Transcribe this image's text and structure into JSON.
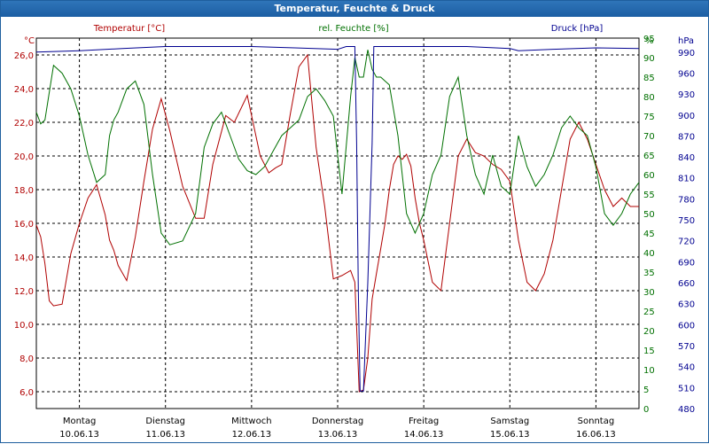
{
  "window": {
    "title": "Temperatur, Feuchte & Druck"
  },
  "colors": {
    "temperature": "#b00000",
    "humidity": "#007000",
    "pressure": "#000090",
    "grid": "#000000"
  },
  "chart_data": {
    "type": "line",
    "title": "Temperatur, Feuchte & Druck",
    "x_categories": [
      {
        "day": "Montag",
        "date": "10.06.13"
      },
      {
        "day": "Dienstag",
        "date": "11.06.13"
      },
      {
        "day": "Mittwoch",
        "date": "12.06.13"
      },
      {
        "day": "Donnerstag",
        "date": "13.06.13"
      },
      {
        "day": "Freitag",
        "date": "14.06.13"
      },
      {
        "day": "Samstag",
        "date": "15.06.13"
      },
      {
        "day": "Sonntag",
        "date": "16.06.13"
      }
    ],
    "x_range_days": [
      0,
      7
    ],
    "grid": true,
    "axes": {
      "temperature": {
        "label": "Temperatur [°C]",
        "unit": "°C",
        "range": [
          5,
          27
        ],
        "ticks": [
          "6,0",
          "8,0",
          "10,0",
          "12,0",
          "14,0",
          "16,0",
          "18,0",
          "20,0",
          "22,0",
          "24,0",
          "26,0"
        ],
        "tick_values": [
          6,
          8,
          10,
          12,
          14,
          16,
          18,
          20,
          22,
          24,
          26
        ]
      },
      "humidity": {
        "label": "rel. Feuchte [%]",
        "unit": "%",
        "range": [
          0,
          95
        ],
        "ticks": [
          "0",
          "5",
          "10",
          "15",
          "20",
          "25",
          "30",
          "35",
          "40",
          "45",
          "50",
          "55",
          "60",
          "65",
          "70",
          "75",
          "80",
          "85",
          "90",
          "95"
        ],
        "tick_values": [
          0,
          5,
          10,
          15,
          20,
          25,
          30,
          35,
          40,
          45,
          50,
          55,
          60,
          65,
          70,
          75,
          80,
          85,
          90,
          95
        ],
        "top_unit_label": "%"
      },
      "pressure": {
        "label": "Druck [hPa]",
        "unit": "hPa",
        "range": [
          480,
          1010
        ],
        "ticks": [
          "480",
          "510",
          "540",
          "570",
          "600",
          "630",
          "660",
          "690",
          "720",
          "750",
          "780",
          "810",
          "840",
          "870",
          "900",
          "930",
          "960",
          "990"
        ],
        "tick_values": [
          480,
          510,
          540,
          570,
          600,
          630,
          660,
          690,
          720,
          750,
          780,
          810,
          840,
          870,
          900,
          930,
          960,
          990
        ],
        "top_unit_label": "hPa"
      }
    },
    "series": [
      {
        "name": "Temperatur [°C]",
        "axis": "temperature",
        "x": [
          0,
          0.05,
          0.1,
          0.15,
          0.2,
          0.3,
          0.4,
          0.5,
          0.6,
          0.7,
          0.8,
          0.85,
          0.9,
          0.95,
          1.05,
          1.15,
          1.25,
          1.35,
          1.45,
          1.55,
          1.7,
          1.85,
          1.95,
          2.05,
          2.2,
          2.3,
          2.45,
          2.6,
          2.7,
          2.78,
          2.85,
          2.95,
          3.05,
          3.15,
          3.25,
          3.35,
          3.45,
          3.55,
          3.65,
          3.7,
          3.75,
          3.8,
          3.85,
          3.9,
          3.95,
          4.0,
          4.05,
          4.1,
          4.15,
          4.2,
          4.25,
          4.3,
          4.35,
          4.4,
          4.45,
          4.5,
          4.6,
          4.7,
          4.8,
          4.9,
          5.0,
          5.1,
          5.2,
          5.3,
          5.4,
          5.5,
          5.6,
          5.7,
          5.8,
          5.9,
          6.0,
          6.1,
          6.2,
          6.3,
          6.4,
          6.5,
          6.6,
          6.7,
          6.8,
          6.9,
          7.0
        ],
        "values": [
          15.9,
          15.2,
          13.6,
          11.4,
          11.1,
          11.2,
          14.2,
          16.0,
          17.5,
          18.3,
          16.5,
          15.0,
          14.4,
          13.5,
          12.6,
          15.2,
          18.5,
          21.6,
          23.4,
          21.5,
          18.2,
          16.3,
          16.3,
          19.5,
          22.4,
          22.0,
          23.6,
          20.0,
          19.0,
          19.3,
          19.5,
          22.5,
          25.3,
          26.0,
          20.5,
          17.0,
          12.7,
          12.9,
          13.2,
          12.5,
          6.0,
          6.1,
          8.0,
          11.5,
          13.0,
          14.5,
          16.0,
          18.0,
          19.5,
          20.0,
          19.8,
          20.1,
          19.4,
          17.5,
          16.0,
          15.0,
          12.5,
          12.0,
          16.0,
          20.0,
          21.0,
          20.2,
          20.0,
          19.5,
          19.2,
          18.5,
          15.0,
          12.5,
          12.0,
          13.0,
          15.0,
          18.0,
          21.0,
          22.0,
          21.0,
          19.5,
          18.0,
          17.0,
          17.5,
          17.0,
          17.0
        ],
        "color": "#b00000"
      },
      {
        "name": "rel. Feuchte [%]",
        "axis": "humidity",
        "x": [
          0,
          0.05,
          0.1,
          0.2,
          0.3,
          0.4,
          0.5,
          0.6,
          0.7,
          0.8,
          0.85,
          0.9,
          0.95,
          1.05,
          1.15,
          1.25,
          1.35,
          1.45,
          1.55,
          1.7,
          1.85,
          1.95,
          2.05,
          2.15,
          2.25,
          2.35,
          2.45,
          2.55,
          2.65,
          2.75,
          2.85,
          2.95,
          3.05,
          3.15,
          3.25,
          3.35,
          3.45,
          3.55,
          3.65,
          3.7,
          3.75,
          3.8,
          3.85,
          3.9,
          3.95,
          4.0,
          4.05,
          4.1,
          4.2,
          4.3,
          4.4,
          4.5,
          4.6,
          4.7,
          4.8,
          4.9,
          5.0,
          5.1,
          5.2,
          5.3,
          5.4,
          5.5,
          5.6,
          5.7,
          5.8,
          5.9,
          6.0,
          6.1,
          6.2,
          6.3,
          6.4,
          6.5,
          6.6,
          6.7,
          6.8,
          6.9,
          7.0
        ],
        "values": [
          76,
          73,
          74,
          88,
          86,
          82,
          75,
          65,
          58,
          60,
          70,
          74,
          76,
          82,
          84,
          78,
          60,
          45,
          42,
          43,
          50,
          67,
          73,
          76,
          70,
          64,
          61,
          60,
          62,
          66,
          70,
          72,
          74,
          80,
          82,
          79,
          75,
          55,
          80,
          90,
          85,
          85,
          92,
          87,
          85,
          85,
          84,
          83,
          70,
          50,
          45,
          50,
          60,
          65,
          80,
          85,
          70,
          60,
          55,
          65,
          57,
          55,
          70,
          62,
          57,
          60,
          65,
          72,
          75,
          72,
          70,
          62,
          50,
          47,
          50,
          55,
          58
        ],
        "color": "#007000"
      },
      {
        "name": "Druck [hPa]",
        "axis": "pressure",
        "x": [
          0,
          0.5,
          1.0,
          1.5,
          2.0,
          2.5,
          3.0,
          3.5,
          3.6,
          3.7,
          3.72,
          3.74,
          3.76,
          3.8,
          3.85,
          3.9,
          3.92,
          4.0,
          4.5,
          5.0,
          5.5,
          5.6,
          6.0,
          6.5,
          7.0
        ],
        "values": [
          990,
          992,
          995,
          998,
          998,
          998,
          996,
          994,
          998,
          998,
          860,
          650,
          505,
          505,
          660,
          860,
          998,
          998,
          998,
          998,
          995,
          992,
          994,
          996,
          995
        ],
        "color": "#000090"
      }
    ]
  }
}
